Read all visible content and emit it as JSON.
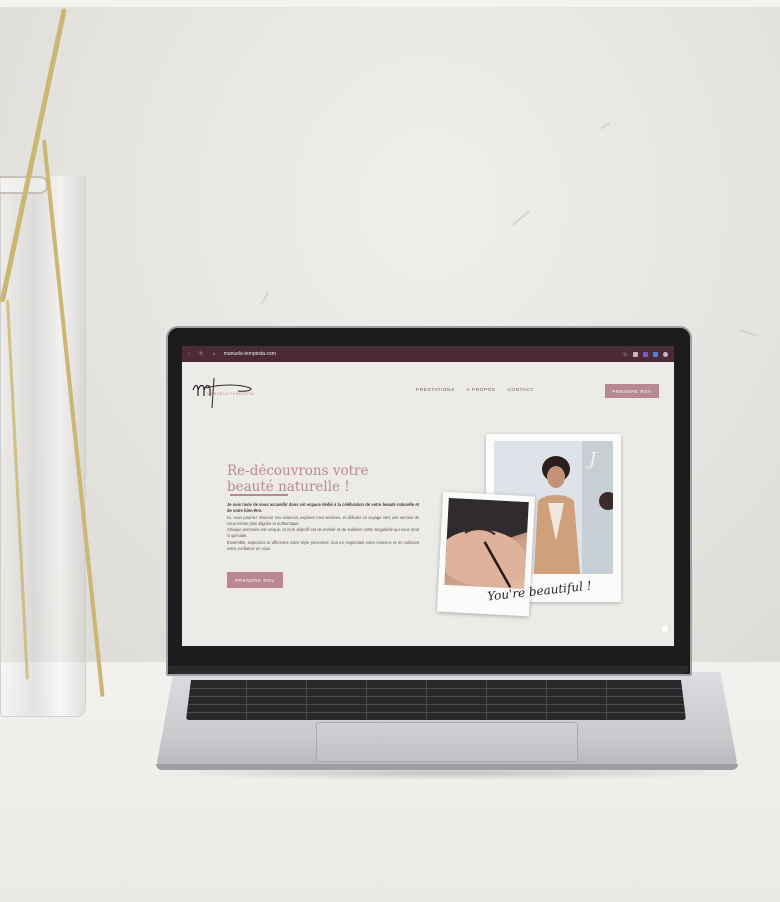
{
  "browser": {
    "url": "manuela-tempesta.com",
    "nav_icons": [
      "back-icon",
      "reload-icon",
      "home-icon"
    ],
    "toolbar_icons": [
      "star-icon",
      "extension-icon",
      "profile-icon"
    ]
  },
  "site": {
    "logo_initials": "mt",
    "logo_name": "MANUELA TEMPESTA",
    "menu": [
      "PRESTATIONS",
      "A PROPOS",
      "CONTACT"
    ],
    "cta_top": "PRENDRE RDV",
    "hero_title": "Re-découvrons votre beauté naturelle !",
    "hero_intro": "Je suis ravie de vous accueillir dans cet espace dédié à la célébration de votre beauté naturelle et de votre bien-être.",
    "hero_p1": "Ici, vous pourrez réserver vos séances, explorer mes services, et débuter un voyage vers une version de vous-même plus alignée et authentique.",
    "hero_p2": "Chaque personne est unique, et mon objectif est de révéler et de sublimer cette singularité qui vous rend si spéciale.",
    "hero_p3": "Ensemble, explorons et affirmons votre style personnel, tout en respectant votre essence et en cultivant votre confiance en vous.",
    "cta_main": "PRENDRE RDV",
    "polaroid_caption": "You're beautiful !"
  },
  "colors": {
    "accent": "#b98895",
    "browser_bar": "#4a2b37",
    "page_bg": "#ecebe8"
  }
}
